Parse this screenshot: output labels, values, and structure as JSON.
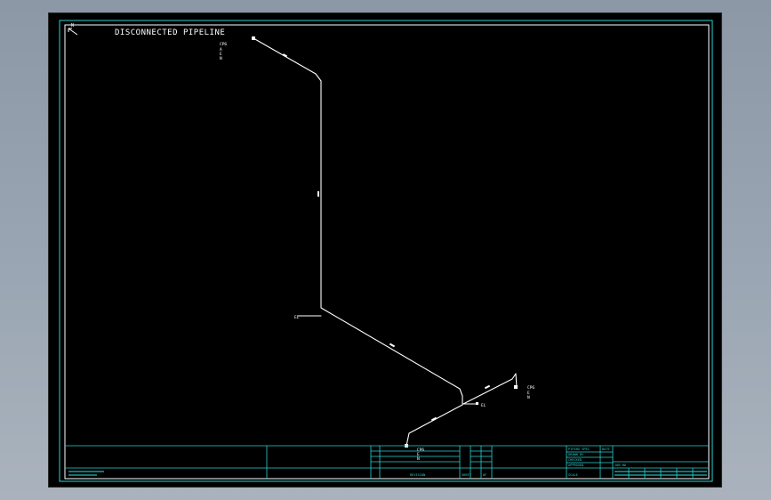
{
  "drawing": {
    "title": "DISCONNECTED PIPELINE",
    "colors": {
      "background": "#000000",
      "pipe": "#ffffff",
      "border": "#29d3d3",
      "viewer_bg": "#8c98a6"
    },
    "north_arrow_label": "N",
    "notes": {
      "top_end": [
        "CP6",
        "A",
        "E",
        "N"
      ],
      "mid_end": [
        "E",
        "N",
        "EL"
      ],
      "right_end": [
        "CP6",
        "E",
        "N"
      ],
      "branch_end": [
        "EL"
      ],
      "bottom_end": [
        "CP6",
        "E",
        "N"
      ]
    },
    "title_block": {
      "label_piping_spec": "PIPING SPEC",
      "label_drawn_by": "DRAWN BY",
      "label_checked": "CHECKED",
      "label_approved": "APPROVED",
      "label_scale": "SCALE",
      "label_date": "DATE",
      "label_job_no": "JOB NO",
      "label_revision": "REVISION",
      "label_sheet": "SHEET",
      "label_of": "OF"
    }
  }
}
